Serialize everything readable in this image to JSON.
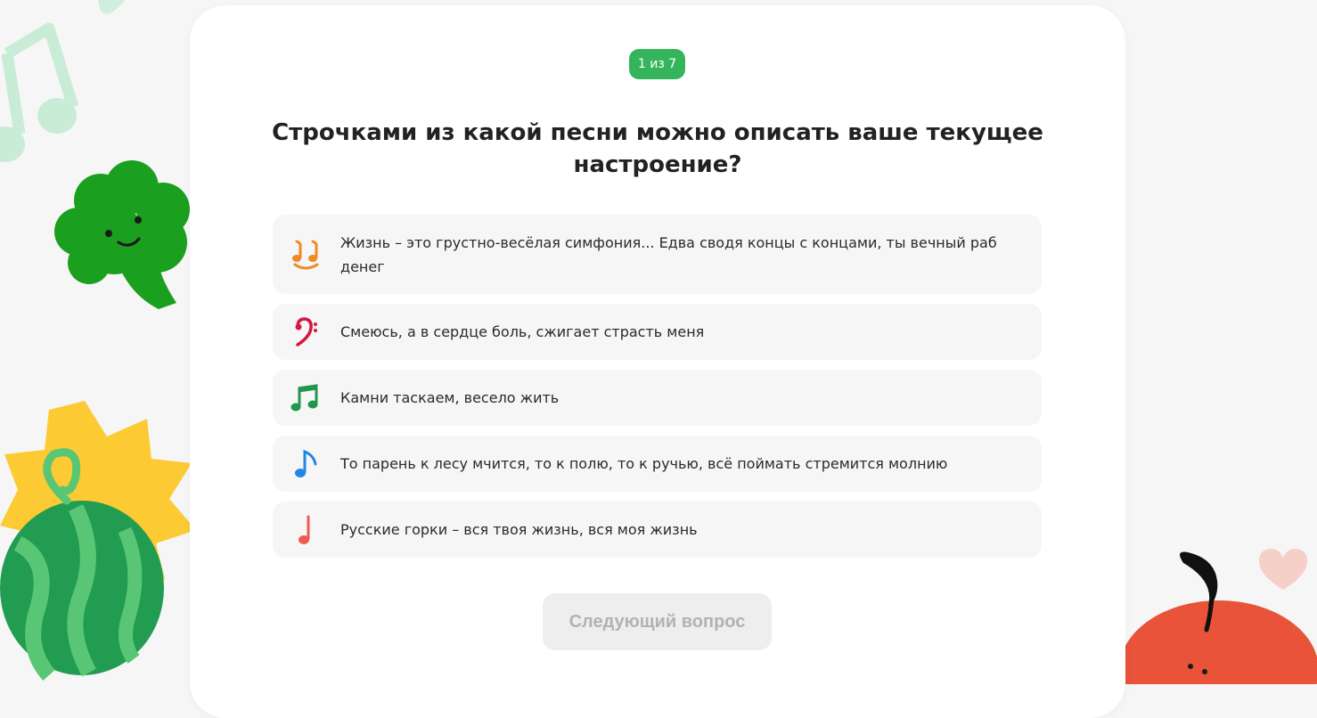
{
  "quiz": {
    "progress": "1 из 7",
    "question": "Строчками из какой песни можно описать ваше текущее настроение?",
    "options": [
      {
        "text": "Жизнь – это грустно-весёлая симфония... Едва сводя концы с концами, ты вечный раб денег",
        "icon": "smiling-notes-icon",
        "color": "#f08a24"
      },
      {
        "text": "Смеюсь, а в сердце боль, сжигает страсть меня",
        "icon": "bass-clef-icon",
        "color": "#d3183f"
      },
      {
        "text": "Камни таскаем, весело жить",
        "icon": "beamed-notes-icon",
        "color": "#21974b"
      },
      {
        "text": "То парень к лесу мчится, то к полю, то к ручью, всё поймать стремится молнию",
        "icon": "eighth-note-icon",
        "color": "#1e88e5"
      },
      {
        "text": "Русские горки – вся твоя жизнь, вся моя жизнь",
        "icon": "quarter-note-icon",
        "color": "#ef5a4c"
      }
    ],
    "next_button": "Следующий вопрос"
  },
  "colors": {
    "accent": "#35b55b",
    "page_background": "#f6f6f6",
    "card_background": "#ffffff",
    "option_background": "#f6f6f6",
    "button_disabled_background": "#eeeeee",
    "button_disabled_text": "#b2b2b2"
  },
  "decorations": [
    "music-note-icon",
    "broccoli-icon",
    "watermelon-icon",
    "sun-icon",
    "apple-icon",
    "heart-icon"
  ]
}
